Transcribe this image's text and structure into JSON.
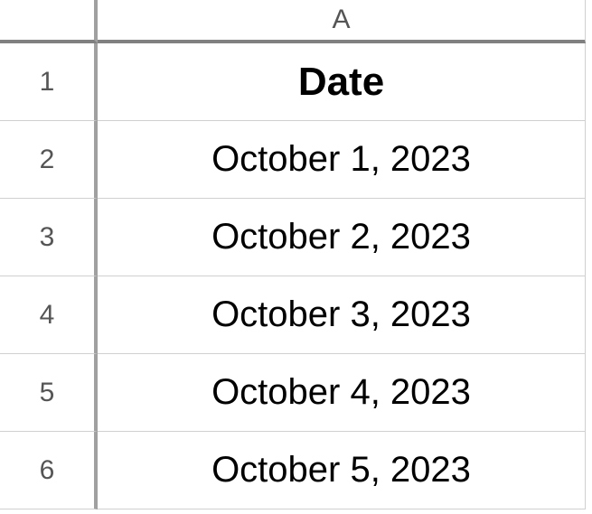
{
  "columns": {
    "A": "A"
  },
  "rows": {
    "1": "1",
    "2": "2",
    "3": "3",
    "4": "4",
    "5": "5",
    "6": "6"
  },
  "cells": {
    "A1": "Date",
    "A2": "October 1, 2023",
    "A3": "October 2, 2023",
    "A4": "October 3, 2023",
    "A5": "October 4, 2023",
    "A6": "October 5, 2023"
  }
}
